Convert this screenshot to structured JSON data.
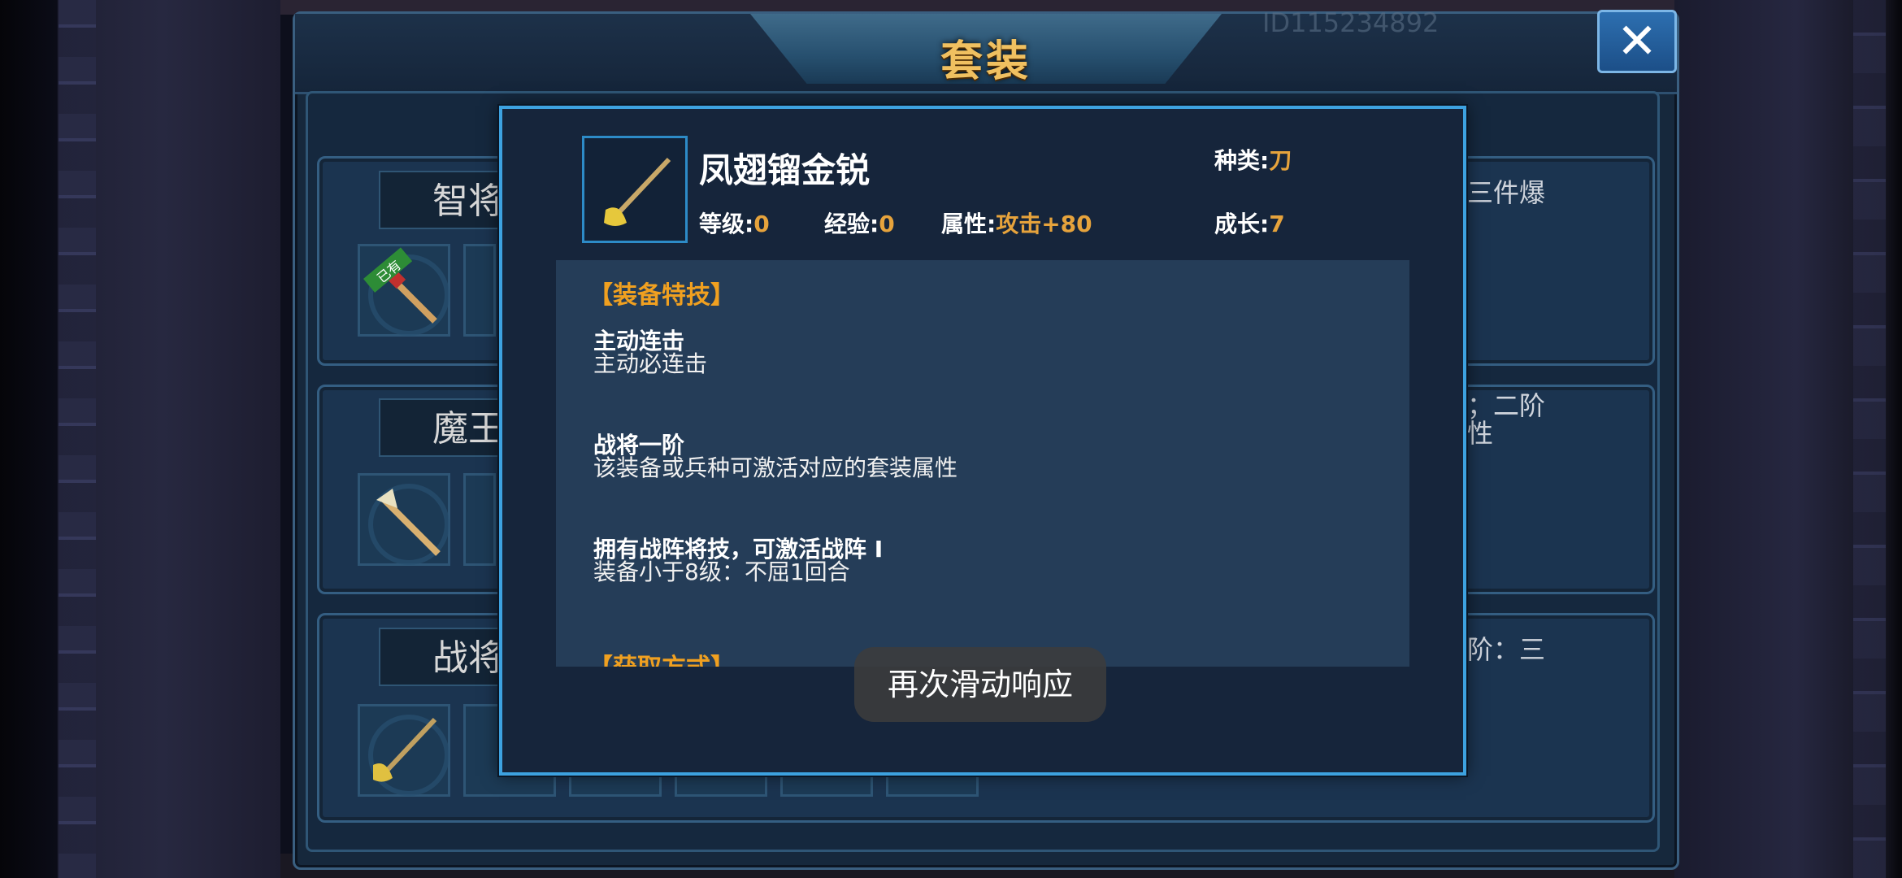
{
  "window": {
    "title": "套装",
    "id_text": "ID115234892",
    "close_label": "✕"
  },
  "rows": [
    {
      "name": "智将",
      "desc": "三件爆",
      "owned_tag": "已有"
    },
    {
      "name": "魔王",
      "desc_line1": "；二阶",
      "desc_line2": "性"
    },
    {
      "name": "战将",
      "desc": "阶：三"
    }
  ],
  "popup": {
    "item_name": "凤翅镏金锐",
    "type_label": "种类:",
    "type_value": "刀",
    "level_label": "等级:",
    "level_value": "0",
    "exp_label": "经验:",
    "exp_value": "0",
    "attr_label": "属性:",
    "attr_value": "攻击+80",
    "growth_label": "成长:",
    "growth_value": "7",
    "section_skill": "【装备特技】",
    "skills": [
      {
        "name": "主动连击",
        "desc": "主动必连击"
      },
      {
        "name": "战将一阶",
        "desc": "该装备或兵种可激活对应的套装属性"
      },
      {
        "name": "拥有战阵将技，可激活战阵 I",
        "desc": "装备小于8级：不屈1回合"
      }
    ],
    "section_obtain": "【获取方式】"
  },
  "toast": {
    "text": "再次滑动响应"
  }
}
